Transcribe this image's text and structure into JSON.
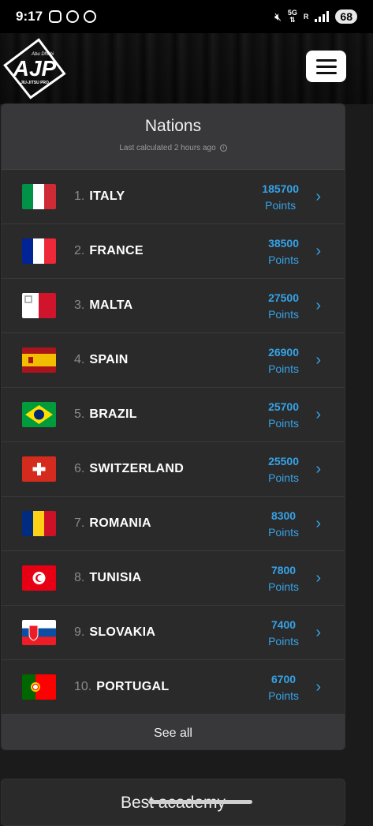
{
  "status_bar": {
    "time": "9:17",
    "network_top": "5G",
    "network_bottom": "R",
    "battery": "68"
  },
  "header": {
    "logo_text": "AJP",
    "logo_sub": "JIU-JITSU PRO",
    "logo_script": "Abu Dhabi",
    "menu_icon": "hamburger-icon"
  },
  "nations": {
    "title": "Nations",
    "subtitle": "Last calculated 2 hours ago",
    "points_label": "Points",
    "rows": [
      {
        "rank": "1.",
        "name": "ITALY",
        "points": "185700",
        "flag": "italy"
      },
      {
        "rank": "2.",
        "name": "FRANCE",
        "points": "38500",
        "flag": "france"
      },
      {
        "rank": "3.",
        "name": "MALTA",
        "points": "27500",
        "flag": "malta"
      },
      {
        "rank": "4.",
        "name": "SPAIN",
        "points": "26900",
        "flag": "spain"
      },
      {
        "rank": "5.",
        "name": "BRAZIL",
        "points": "25700",
        "flag": "brazil"
      },
      {
        "rank": "6.",
        "name": "SWITZERLAND",
        "points": "25500",
        "flag": "switzerland"
      },
      {
        "rank": "7.",
        "name": "ROMANIA",
        "points": "8300",
        "flag": "romania"
      },
      {
        "rank": "8.",
        "name": "TUNISIA",
        "points": "7800",
        "flag": "tunisia"
      },
      {
        "rank": "9.",
        "name": "SLOVAKIA",
        "points": "7400",
        "flag": "slovakia"
      },
      {
        "rank": "10.",
        "name": "PORTUGAL",
        "points": "6700",
        "flag": "portugal"
      }
    ],
    "see_all_label": "See all"
  },
  "best_academy": {
    "title": "Best academy"
  },
  "colors": {
    "accent": "#36a3e6",
    "card_bg": "#2a2a2b",
    "card_header_bg": "#38383a"
  }
}
